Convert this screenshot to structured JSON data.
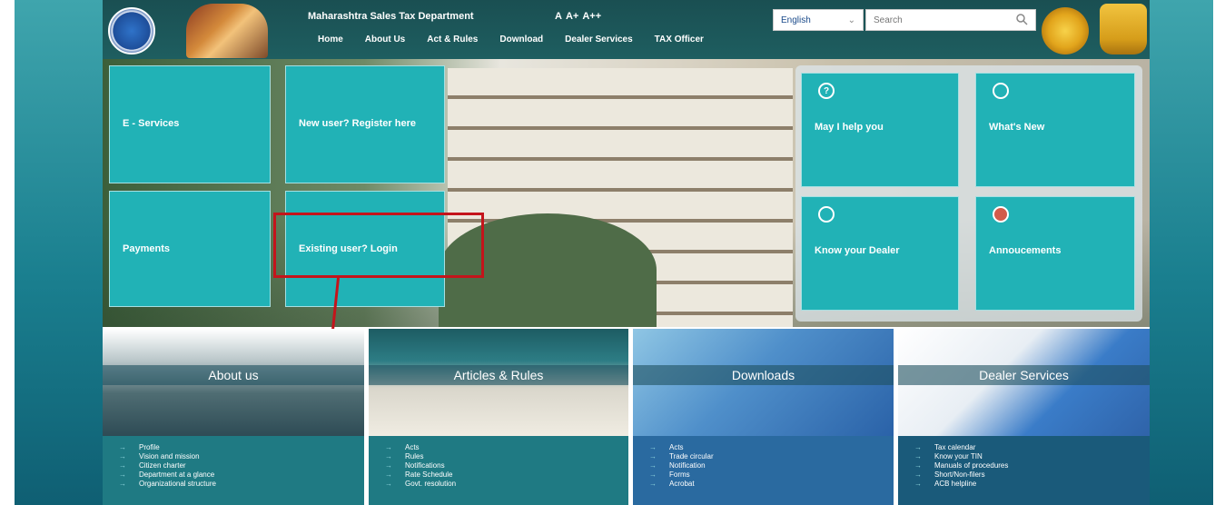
{
  "header": {
    "site_title": "Maharashtra Sales Tax Department",
    "font_sizes": [
      "A",
      "A+",
      "A++"
    ],
    "nav": [
      "Home",
      "About Us",
      "Act & Rules",
      "Download",
      "Dealer Services",
      "TAX Officer"
    ],
    "language": "English",
    "search_placeholder": "Search"
  },
  "tiles_left": [
    {
      "label": "E - Services"
    },
    {
      "label": "New user? Register here"
    },
    {
      "label": "Payments"
    },
    {
      "label": "Existing user? Login"
    }
  ],
  "tiles_right": [
    {
      "label": "May I help you",
      "icon": "help-icon"
    },
    {
      "label": "What's New",
      "icon": "news-icon"
    },
    {
      "label": "Know your Dealer",
      "icon": "dealer-icon"
    },
    {
      "label": "Annoucements",
      "icon": "announcement-icon"
    }
  ],
  "cards": [
    {
      "title": "About us",
      "links": [
        "Profile",
        "Vision and mission",
        "Citizen charter",
        "Department at a glance",
        "Organizational structure"
      ]
    },
    {
      "title": "Articles & Rules",
      "links": [
        "Acts",
        "Rules",
        "Notifications",
        "Rate Schedule",
        "Govt. resolution"
      ]
    },
    {
      "title": "Downloads",
      "links": [
        "Acts",
        "Trade circular",
        "Notification",
        "Forms",
        "Acrobat"
      ]
    },
    {
      "title": "Dealer Services",
      "links": [
        "Tax calendar",
        "Know your TIN",
        "Manuals of procedures",
        "Short/Non-filers",
        "ACB helpline"
      ]
    }
  ],
  "colors": {
    "tile": "#21b2b6",
    "header": "#1e5e60",
    "highlight": "#c4141b"
  }
}
